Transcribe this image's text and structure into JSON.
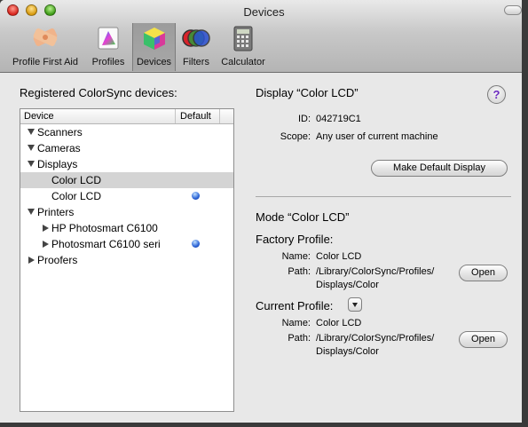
{
  "window": {
    "title": "Devices"
  },
  "toolbar": {
    "items": [
      {
        "label": "Profile First Aid",
        "icon": "first-aid-icon"
      },
      {
        "label": "Profiles",
        "icon": "profiles-icon"
      },
      {
        "label": "Devices",
        "icon": "devices-icon",
        "selected": true
      },
      {
        "label": "Filters",
        "icon": "filters-icon"
      },
      {
        "label": "Calculator",
        "icon": "calculator-icon"
      }
    ]
  },
  "left": {
    "title": "Registered ColorSync devices:",
    "columns": {
      "device": "Device",
      "default": "Default"
    },
    "rows": [
      {
        "label": "Scanners"
      },
      {
        "label": "Cameras"
      },
      {
        "label": "Displays"
      },
      {
        "label": "Color LCD"
      },
      {
        "label": "Color LCD"
      },
      {
        "label": "Printers"
      },
      {
        "label": "HP Photosmart C6100"
      },
      {
        "label": "Photosmart C6100 seri"
      },
      {
        "label": "Proofers"
      }
    ]
  },
  "detail": {
    "display_title": "Display “Color LCD”",
    "id_label": "ID:",
    "id_value": "042719C1",
    "scope_label": "Scope:",
    "scope_value": "Any user of current machine",
    "make_default_button": "Make Default Display",
    "mode_title": "Mode “Color LCD”",
    "factory_profile_label": "Factory Profile:",
    "factory_name_label": "Name:",
    "factory_name_value": "Color LCD",
    "factory_path_label": "Path:",
    "factory_path_line1": "/Library/ColorSync/Profiles/",
    "factory_path_line2": "Displays/Color",
    "open_button": "Open",
    "current_profile_label": "Current Profile:",
    "current_name_label": "Name:",
    "current_name_value": "Color LCD",
    "current_path_label": "Path:",
    "current_path_line1": "/Library/ColorSync/Profiles/",
    "current_path_line2": "Displays/Color",
    "help_symbol": "?"
  },
  "colors": {
    "help_accent": "#6b2bbf",
    "default_dot": "#2a62d6"
  }
}
